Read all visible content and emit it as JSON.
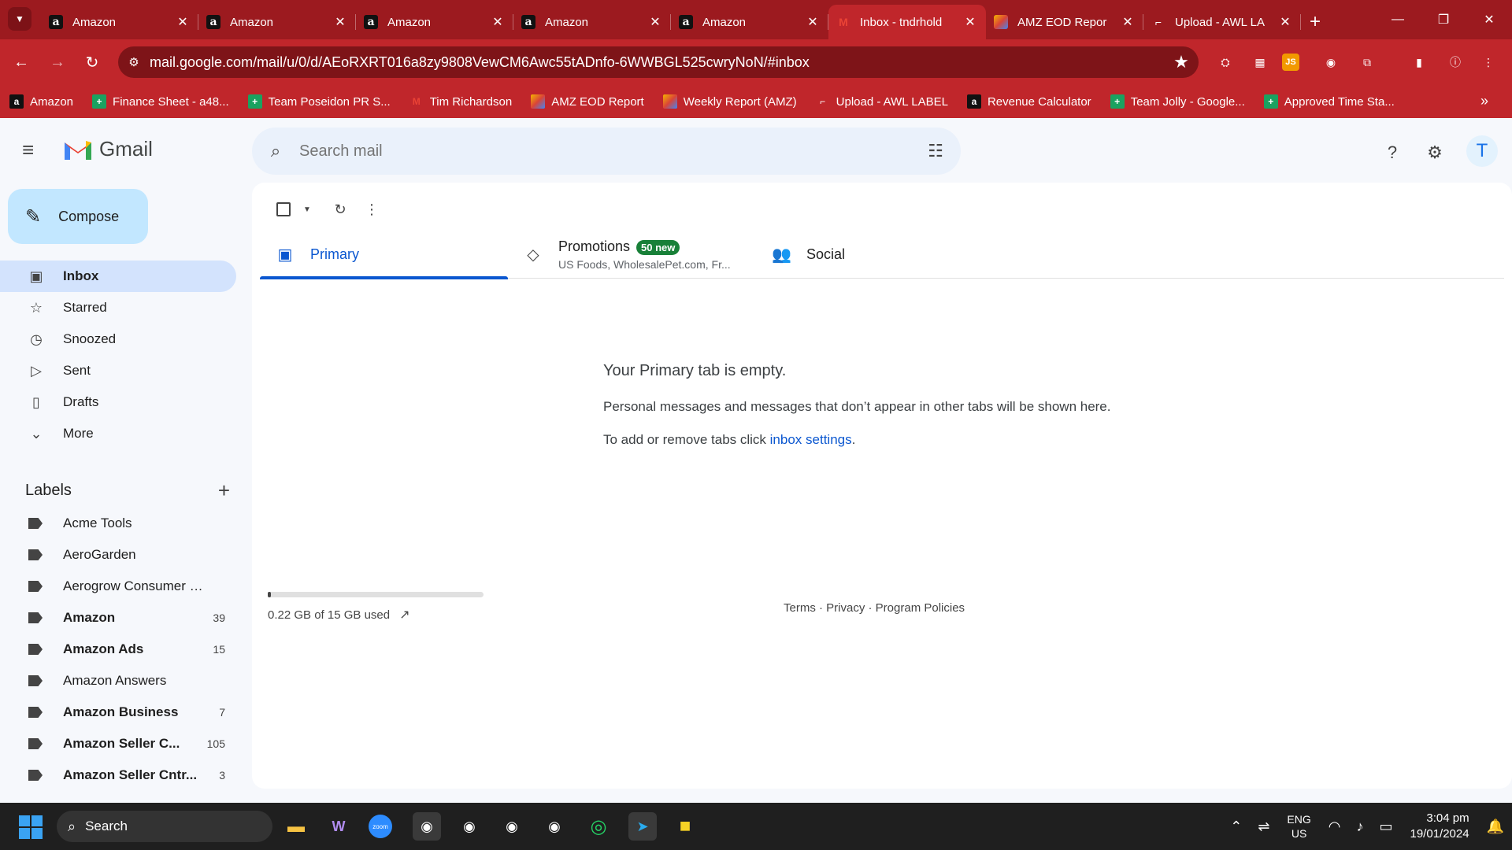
{
  "browser": {
    "tabs": [
      {
        "title": "Amazon",
        "favicon": "amazon-icon",
        "active": false
      },
      {
        "title": "Amazon",
        "favicon": "amazon-icon",
        "active": false
      },
      {
        "title": "Amazon",
        "favicon": "amazon-icon",
        "active": false
      },
      {
        "title": "Amazon",
        "favicon": "amazon-icon",
        "active": false
      },
      {
        "title": "Amazon",
        "favicon": "amazon-icon",
        "active": false
      },
      {
        "title": "Inbox - tndrhold",
        "favicon": "gmail-icon",
        "active": true
      },
      {
        "title": "AMZ EOD Repor",
        "favicon": "eod-report-icon",
        "active": false
      },
      {
        "title": "Upload - AWL LA",
        "favicon": "upload-icon",
        "active": false
      }
    ],
    "url": "mail.google.com/mail/u/0/d/AEoRXRT016a8zy9808VewCM6Awc55tADnfo-6WWBGL525cwryNoN/#inbox",
    "bookmarks": [
      {
        "label": "Amazon",
        "favicon": "amazon-icon"
      },
      {
        "label": "Finance Sheet - a48...",
        "favicon": "sheets-icon"
      },
      {
        "label": "Team Poseidon PR S...",
        "favicon": "sheets-icon"
      },
      {
        "label": "Tim Richardson",
        "favicon": "gmail-icon"
      },
      {
        "label": "AMZ EOD Report",
        "favicon": "eod-report-icon"
      },
      {
        "label": "Weekly Report (AMZ)",
        "favicon": "eod-report-icon"
      },
      {
        "label": "Upload - AWL LABEL",
        "favicon": "upload-icon"
      },
      {
        "label": "Revenue Calculator",
        "favicon": "amazon-icon"
      },
      {
        "label": "Team Jolly - Google...",
        "favicon": "sheets-icon"
      },
      {
        "label": "Approved Time Sta...",
        "favicon": "sheets-icon"
      }
    ],
    "theme_color": "#c0262b"
  },
  "gmail": {
    "brand": "Gmail",
    "search_placeholder": "Search mail",
    "compose_label": "Compose",
    "avatar_initial": "T",
    "nav": [
      {
        "label": "Inbox",
        "icon": "inbox-icon",
        "active": true
      },
      {
        "label": "Starred",
        "icon": "star-icon",
        "active": false
      },
      {
        "label": "Snoozed",
        "icon": "clock-icon",
        "active": false
      },
      {
        "label": "Sent",
        "icon": "send-icon",
        "active": false
      },
      {
        "label": "Drafts",
        "icon": "draft-icon",
        "active": false
      },
      {
        "label": "More",
        "icon": "chevron-down-icon",
        "active": false
      }
    ],
    "labels_title": "Labels",
    "labels": [
      {
        "name": "Acme Tools",
        "count": "",
        "bold": false
      },
      {
        "name": "AeroGarden",
        "count": "",
        "bold": false
      },
      {
        "name": "Aerogrow Consumer Se...",
        "count": "",
        "bold": false
      },
      {
        "name": "Amazon",
        "count": "39",
        "bold": true
      },
      {
        "name": "Amazon Ads",
        "count": "15",
        "bold": true
      },
      {
        "name": "Amazon Answers",
        "count": "",
        "bold": false
      },
      {
        "name": "Amazon Business",
        "count": "7",
        "bold": true
      },
      {
        "name": "Amazon Seller C...",
        "count": "105",
        "bold": true
      },
      {
        "name": "Amazon Seller Cntr...",
        "count": "3",
        "bold": true
      }
    ],
    "category_tabs": {
      "primary": "Primary",
      "promotions": "Promotions",
      "promotions_badge": "50 new",
      "promotions_sub": "US Foods, WholesalePet.com, Fr...",
      "social": "Social"
    },
    "empty": {
      "title": "Your Primary tab is empty.",
      "line1": "Personal messages and messages that don’t appear in other tabs will be shown here.",
      "line2_prefix": "To add or remove tabs click ",
      "line2_link": "inbox settings",
      "line2_suffix": "."
    },
    "storage": {
      "text": "0.22 GB of 15 GB used",
      "used_fraction": 0.015
    },
    "footer": "Terms · Privacy · Program Policies"
  },
  "taskbar": {
    "search_placeholder": "Search",
    "lang_line1": "ENG",
    "lang_line2": "US",
    "time": "3:04 pm",
    "date": "19/01/2024"
  }
}
